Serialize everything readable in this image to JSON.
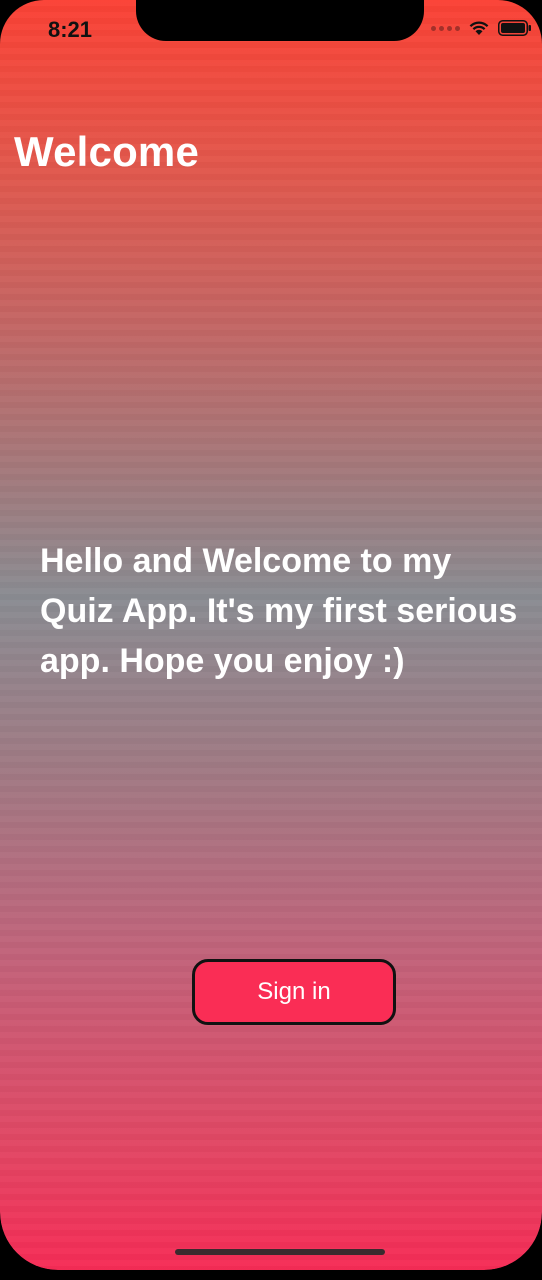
{
  "status_bar": {
    "time": "8:21"
  },
  "header": {
    "title": "Welcome"
  },
  "main": {
    "welcome_message": "Hello and Welcome to my Quiz App. It's my first serious app. Hope you enjoy :)",
    "sign_in_label": "Sign in"
  },
  "colors": {
    "gradient_top": "#fb4135",
    "gradient_mid": "#8a8c92",
    "gradient_bottom": "#f62c56",
    "button_fill": "#fa2d55",
    "button_border": "#111111",
    "text": "#ffffff"
  },
  "icons": {
    "signal": "cellular-signal-icon",
    "wifi": "wifi-icon",
    "battery": "battery-icon"
  }
}
